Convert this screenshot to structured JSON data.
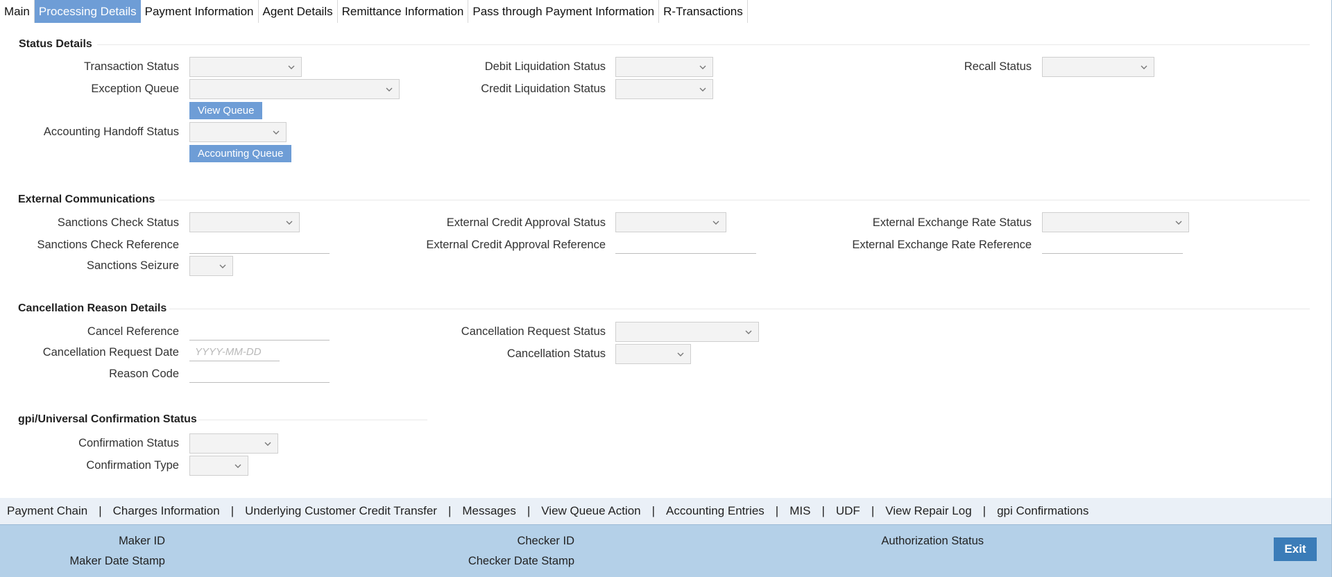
{
  "tabs": [
    {
      "label": "Main"
    },
    {
      "label": "Processing Details"
    },
    {
      "label": "Payment Information"
    },
    {
      "label": "Agent Details"
    },
    {
      "label": "Remittance Information"
    },
    {
      "label": "Pass through Payment Information"
    },
    {
      "label": "R-Transactions"
    }
  ],
  "status_details": {
    "title": "Status Details",
    "transaction_status": "Transaction Status",
    "exception_queue": "Exception Queue",
    "view_queue_btn": "View Queue",
    "accounting_handoff_status": "Accounting Handoff Status",
    "accounting_queue_btn": "Accounting Queue",
    "debit_liquidation_status": "Debit Liquidation Status",
    "credit_liquidation_status": "Credit Liquidation Status",
    "recall_status": "Recall Status"
  },
  "external_comm": {
    "title": "External Communications",
    "sanctions_check_status": "Sanctions Check Status",
    "sanctions_check_reference": "Sanctions Check Reference",
    "sanctions_seizure": "Sanctions Seizure",
    "ext_credit_approval_status": "External Credit Approval Status",
    "ext_credit_approval_reference": "External Credit Approval Reference",
    "ext_exchange_rate_status": "External Exchange Rate Status",
    "ext_exchange_rate_reference": "External Exchange Rate Reference"
  },
  "cancellation": {
    "title": "Cancellation Reason Details",
    "cancel_reference": "Cancel Reference",
    "cancellation_request_date": "Cancellation Request Date",
    "date_placeholder": "YYYY-MM-DD",
    "reason_code": "Reason Code",
    "cancellation_request_status": "Cancellation Request Status",
    "cancellation_status": "Cancellation Status"
  },
  "gpi": {
    "title": "gpi/Universal Confirmation Status",
    "confirmation_status": "Confirmation Status",
    "confirmation_type": "Confirmation Type"
  },
  "bottom_links": [
    "Payment Chain",
    "Charges Information",
    "Underlying Customer Credit Transfer",
    "Messages",
    "View Queue Action",
    "Accounting Entries",
    "MIS",
    "UDF",
    "View Repair Log",
    "gpi Confirmations"
  ],
  "footer": {
    "maker_id": "Maker ID",
    "maker_date_stamp": "Maker Date Stamp",
    "checker_id": "Checker ID",
    "checker_date_stamp": "Checker Date Stamp",
    "authorization_status": "Authorization Status",
    "exit_label": "Exit"
  },
  "colors": {
    "active_tab": "#6e9dd6",
    "button": "#6e9dd6",
    "footer_bg": "#b4d0e8",
    "exit_button": "#3b7cb8"
  }
}
